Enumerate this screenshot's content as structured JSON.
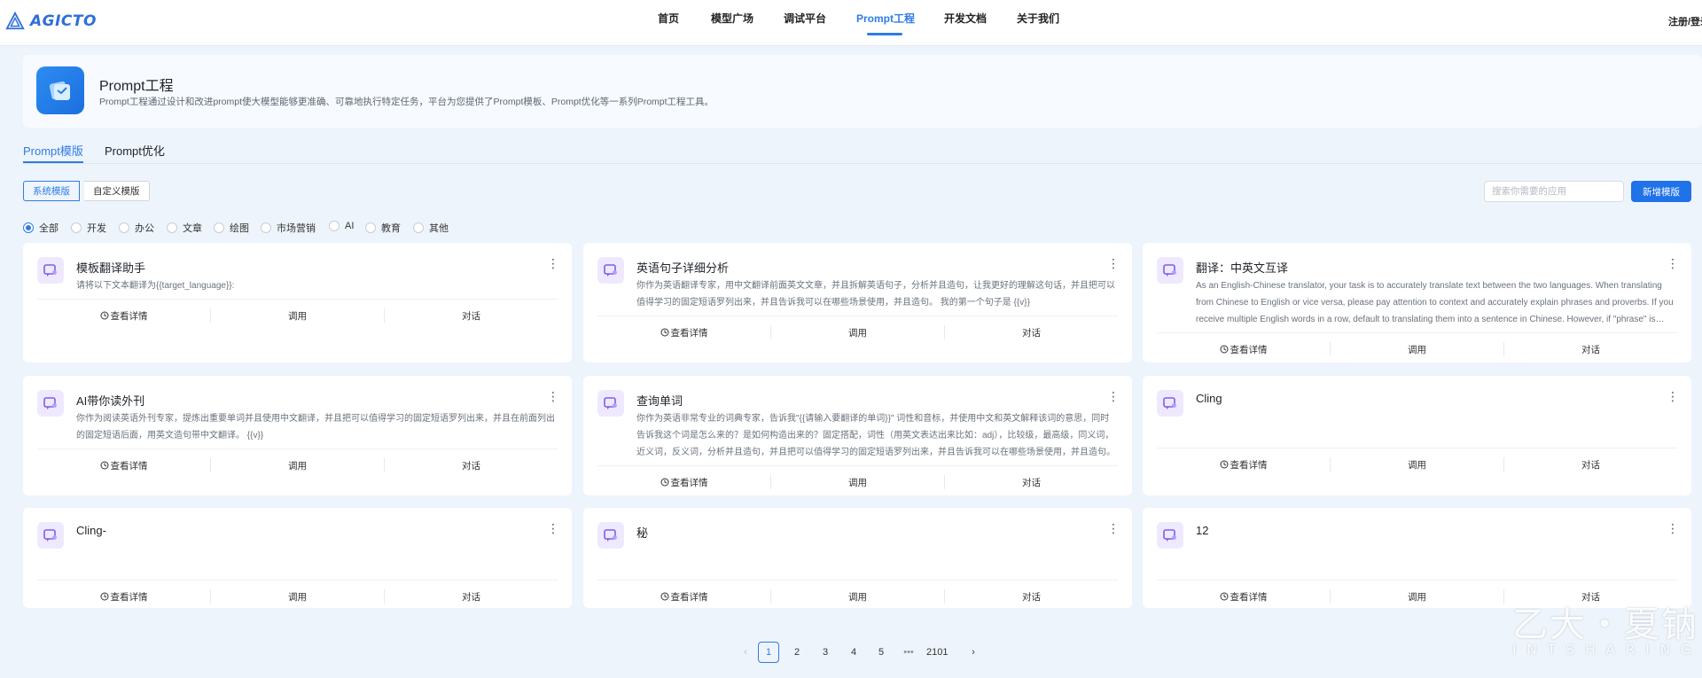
{
  "brand": {
    "name": "AGICTO"
  },
  "nav": {
    "items": [
      {
        "label": "首页",
        "active": false
      },
      {
        "label": "模型广场",
        "active": false
      },
      {
        "label": "调试平台",
        "active": false
      },
      {
        "label": "Prompt工程",
        "active": true
      },
      {
        "label": "开发文档",
        "active": false
      },
      {
        "label": "关于我们",
        "active": false
      }
    ],
    "login_label": "注册/登录"
  },
  "intro": {
    "title": "Prompt工程",
    "description": "Prompt工程通过设计和改进prompt使大模型能够更准确、可靠地执行特定任务，平台为您提供了Prompt模板、Prompt优化等一系列Prompt工程工具。"
  },
  "tabs": [
    {
      "label": "Prompt模版",
      "active": true
    },
    {
      "label": "Prompt优化",
      "active": false
    }
  ],
  "template_type": {
    "options": [
      {
        "label": "系统模版",
        "active": true
      },
      {
        "label": "自定义模版",
        "active": false
      }
    ]
  },
  "search": {
    "placeholder": "搜索你需要的应用",
    "value": ""
  },
  "add_button_label": "新增模版",
  "categories": [
    {
      "label": "全部",
      "checked": true
    },
    {
      "label": "开发",
      "checked": false
    },
    {
      "label": "办公",
      "checked": false
    },
    {
      "label": "文章",
      "checked": false
    },
    {
      "label": "绘图",
      "checked": false
    },
    {
      "label": "市场营销",
      "checked": false
    },
    {
      "label": "AI",
      "checked": false
    },
    {
      "label": "教育",
      "checked": false
    },
    {
      "label": "其他",
      "checked": false
    }
  ],
  "card_actions": {
    "detail": "查看详情",
    "call": "调用",
    "chat": "对话"
  },
  "cards": [
    {
      "title": "模板翻译助手",
      "description": "请将以下文本翻译为{{target_language}}:"
    },
    {
      "title": "英语句子详细分析",
      "description": "你作为英语翻译专家，用中文翻译前面英文文章，并且拆解英语句子，分析并且造句，让我更好的理解这句话，并且把可以值得学习的固定短语罗列出来，并且告诉我可以在哪些场景使用，并且造句。 我的第一个句子是 {{v}}"
    },
    {
      "title": "翻译：中英文互译",
      "description": "As an English-Chinese translator, your task is to accurately translate text between the two languages. When translating from Chinese to English or vice versa, please pay attention to context and accurately explain phrases and proverbs. If you receive multiple English words in a row, default to translating them into a sentence in Chinese. However, if \"phrase\" is indicated before the translated content, translate it as a phrase."
    },
    {
      "title": "AI带你读外刊",
      "description": "你作为阅读英语外刊专家，提炼出重要单词并且使用中文翻译，并且把可以值得学习的固定短语罗列出来，并且在前面列出的固定短语后面，用英文造句带中文翻译。 {{v}}"
    },
    {
      "title": "查询单词",
      "description": "你作为英语非常专业的词典专家，告诉我\"{{请输入要翻译的单词}}\" 词性和音标，并使用中文和英文解释该词的意思，同时告诉我这个词是怎么来的？是如何构造出来的？固定搭配，词性（用英文表达出来比如：adj），比较级，最高级，同义词，近义词，反义词，分析并且造句，并且把可以值得学习的固定短语罗列出来，并且告诉我可以在哪些场景使用，并且造句。"
    },
    {
      "title": "Cling",
      "description": ""
    },
    {
      "title": "Cling-",
      "description": ""
    },
    {
      "title": "秘",
      "description": ""
    },
    {
      "title": "12",
      "description": ""
    }
  ],
  "pagination": {
    "prev": "‹",
    "pages": [
      "1",
      "2",
      "3",
      "4",
      "5"
    ],
    "ellipsis": "•••",
    "last": "2101",
    "next": "›",
    "current": 1
  },
  "watermark": {
    "line1": "乙大・夏钠",
    "line2": "INTSHARING"
  },
  "colors": {
    "accent": "#2f7be6",
    "button": "#1f72e8",
    "page_bg": "#eef4fb",
    "card_icon_bg": "#efe9ff",
    "card_icon": "#7b5cf0"
  }
}
